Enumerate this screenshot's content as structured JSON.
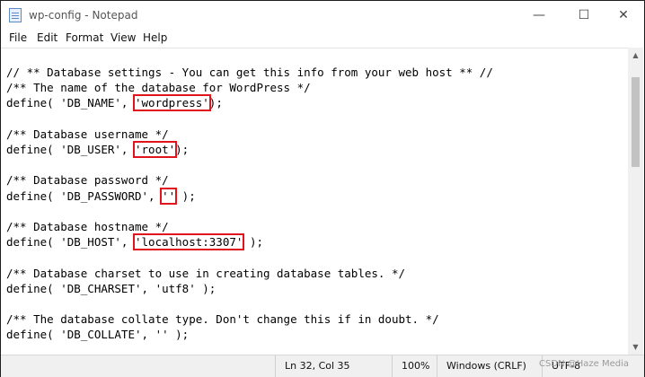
{
  "window": {
    "title": "wp-config - Notepad",
    "controls": {
      "minimize": "—",
      "maximize": "☐",
      "close": "✕"
    }
  },
  "menu": [
    "File",
    "Edit",
    "Format",
    "View",
    "Help"
  ],
  "editor": {
    "lines": [
      {
        "text": "// ** Database settings - You can get this info from your web host ** //"
      },
      {
        "text": "/** The name of the database for WordPress */"
      },
      {
        "pre": "define( 'DB_NAME', ",
        "hl": "'wordpress'",
        "post": ");"
      },
      {
        "text": ""
      },
      {
        "text": "/** Database username */"
      },
      {
        "pre": "define( 'DB_USER', ",
        "hl": "'root'",
        "post": ");"
      },
      {
        "text": ""
      },
      {
        "text": "/** Database password */"
      },
      {
        "pre": "define( 'DB_PASSWORD', ",
        "hl": "''",
        "post": " );"
      },
      {
        "text": ""
      },
      {
        "text": "/** Database hostname */"
      },
      {
        "pre": "define( 'DB_HOST', ",
        "hl": "'localhost:3307'",
        "post": " );"
      },
      {
        "text": ""
      },
      {
        "text": "/** Database charset to use in creating database tables. */"
      },
      {
        "text": "define( 'DB_CHARSET', 'utf8' );"
      },
      {
        "text": ""
      },
      {
        "text": "/** The database collate type. Don't change this if in doubt. */"
      },
      {
        "text": "define( 'DB_COLLATE', '' );"
      }
    ],
    "highlight_color": "#e0141c"
  },
  "statusbar": {
    "position": "Ln 32, Col 35",
    "zoom": "100%",
    "line_ending": "Windows (CRLF)",
    "encoding": "UTF-8"
  },
  "watermark": "CSDN @Haze Media"
}
